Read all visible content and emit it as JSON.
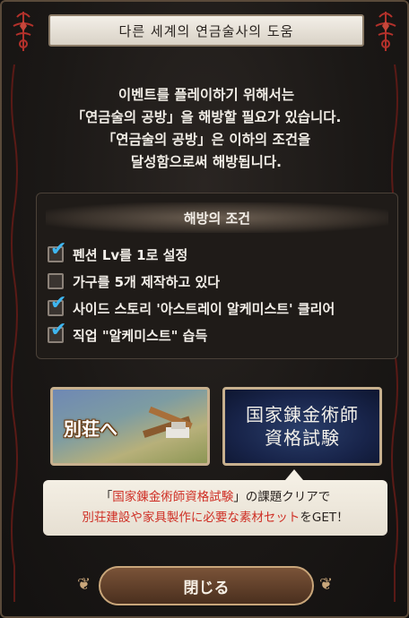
{
  "title": "다른 세계의 연금술사의 도움",
  "intro": {
    "line1": "이벤트를 플레이하기 위해서는",
    "line2": "「연금술의 공방」을 해방할 필요가 있습니다.",
    "line3": "「연금술의 공방」은 이하의 조건을",
    "line4": "달성함으로써 해방됩니다."
  },
  "conditions": {
    "header": "해방의 조건",
    "items": [
      {
        "label": "펜션 Lv를 1로 설정",
        "checked": true
      },
      {
        "label": "가구를 5개 제작하고 있다",
        "checked": false
      },
      {
        "label": "사이드 스토리 '아스트레이 알케미스트' 클리어",
        "checked": true
      },
      {
        "label": "직업 \"알케미스트\" 습득",
        "checked": true
      }
    ]
  },
  "buttons": {
    "villa_label": "別荘へ",
    "exam_line1": "国家錬金術師",
    "exam_line2": "資格試験",
    "close_label": "閉じる"
  },
  "tooltip": {
    "l1_a": "「",
    "l1_red": "国家錬金術師資格試験",
    "l1_b": "」の課題クリアで",
    "l2_red": "別荘建設や家具製作に必要な素材セット",
    "l2_b": "をGET！"
  },
  "icons": {
    "check": "checkmark-icon",
    "ornament": "flamel-ornament-icon"
  },
  "colors": {
    "check": "#3fb6f0",
    "tooltip_red": "#cf2f25",
    "ornament": "#b3312b"
  }
}
